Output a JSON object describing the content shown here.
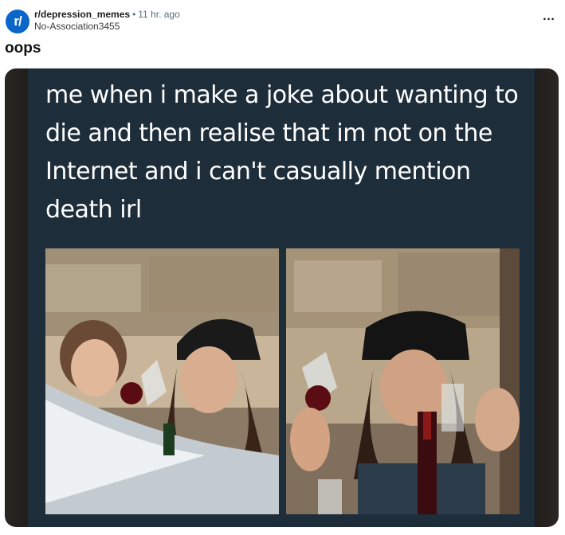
{
  "post": {
    "subreddit_icon": "r/",
    "subreddit": "r/depression_memes",
    "separator": "•",
    "time": "11 hr. ago",
    "author": "No-Association3455",
    "title": "oops",
    "more_icon": "more-options-icon"
  },
  "meme": {
    "caption": "me when i make a joke about wanting to die and then realise that im not on the Internet and i can't casually mention death irl"
  },
  "colors": {
    "sub_avatar": "#0a66c8",
    "meme_background": "#1d2d3a"
  }
}
